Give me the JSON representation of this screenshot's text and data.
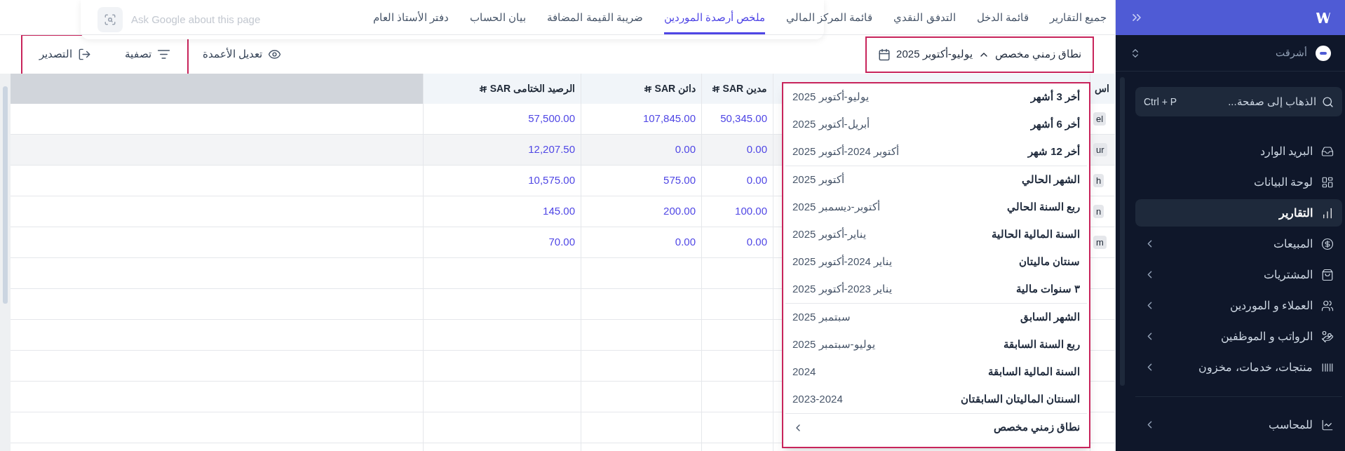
{
  "assistant_popup": {
    "placeholder": "Ask Google about this page"
  },
  "tabs": [
    {
      "label": "جميع التقارير",
      "selected": false
    },
    {
      "label": "قائمة الدخل",
      "selected": false
    },
    {
      "label": "التدفق النقدي",
      "selected": false
    },
    {
      "label": "قائمة المركز المالي",
      "selected": false
    },
    {
      "label": "ملخص أرصدة الموردين",
      "selected": true
    },
    {
      "label": "ضريبة القيمة المضافة",
      "selected": false
    },
    {
      "label": "بيان الحساب",
      "selected": false
    },
    {
      "label": "دفتر الأستاذ العام",
      "selected": false
    }
  ],
  "toolbar": {
    "date_range": {
      "label": "نطاق زمني مخصص",
      "value": "يوليو-أكتوبر 2025",
      "expanded": true,
      "highlighted": true
    },
    "actions": [
      {
        "kind": "columns",
        "label": "تعديل الأعمدة",
        "highlighted": false
      },
      {
        "kind": "filter",
        "label": "تصفية",
        "highlighted": true
      },
      {
        "kind": "export",
        "label": "التصدير",
        "highlighted": true
      }
    ]
  },
  "table": {
    "columns": [
      {
        "label": "اس"
      },
      {},
      {
        "label": "مدين SAR",
        "currency": true
      },
      {
        "label": "دائن SAR",
        "currency": true
      },
      {
        "label": "الرصيد الختامى SAR",
        "currency": true
      }
    ],
    "rows": [
      {
        "selected": false,
        "cells": [
          "el",
          "",
          "50,345.00",
          "107,845.00",
          "57,500.00"
        ]
      },
      {
        "selected": true,
        "cells": [
          "ur",
          "",
          "0.00",
          "0.00",
          "12,207.50"
        ]
      },
      {
        "selected": false,
        "cells": [
          "h",
          "",
          "0.00",
          "575.00",
          "10,575.00"
        ]
      },
      {
        "selected": false,
        "cells": [
          "n",
          "",
          "100.00",
          "200.00",
          "145.00"
        ]
      },
      {
        "selected": false,
        "cells": [
          "m",
          "",
          "0.00",
          "0.00",
          "70.00"
        ]
      }
    ]
  },
  "range_menu": {
    "highlighted": true,
    "groups": [
      [
        {
          "label": "أخر 3 أشهر",
          "range": "يوليو-أكتوبر 2025"
        },
        {
          "label": "أخر 6 أشهر",
          "range": "أبريل-أكتوبر 2025"
        },
        {
          "label": "أخر 12 شهر",
          "range": "أكتوبر 2024-أكتوبر 2025"
        }
      ],
      [
        {
          "label": "الشهر الحالي",
          "range": "أكتوبر 2025"
        },
        {
          "label": "ربع السنة الحالي",
          "range": "أكتوبر-ديسمبر 2025"
        },
        {
          "label": "السنة المالية الحالية",
          "range": "يناير-أكتوبر 2025"
        },
        {
          "label": "سنتان ماليتان",
          "range": "يناير 2024-أكتوبر 2025"
        },
        {
          "label": "٣ سنوات مالية",
          "range": "يناير 2023-أكتوبر 2025"
        }
      ],
      [
        {
          "label": "الشهر السابق",
          "range": "سبتمبر 2025"
        },
        {
          "label": "ربع السنة السابقة",
          "range": "يوليو-سبتمبر 2025"
        },
        {
          "label": "السنة المالية السابقة",
          "range": "2024"
        },
        {
          "label": "السنتان الماليتان السابقتان",
          "range": "2023-2024"
        }
      ]
    ],
    "custom": {
      "label": "نطاق زمني مخصص"
    }
  },
  "sidebar": {
    "account": {
      "name": "أشرقت"
    },
    "search": {
      "placeholder": "الذهاب إلى صفحة...",
      "shortcut": "Ctrl + P"
    },
    "items": [
      {
        "kind": "inbox",
        "label": "البريد الوارد",
        "selected": false,
        "expandable": false
      },
      {
        "kind": "dashboard",
        "label": "لوحة البيانات",
        "selected": false,
        "expandable": false
      },
      {
        "kind": "reports",
        "label": "التقارير",
        "selected": true,
        "expandable": false
      },
      {
        "kind": "sales",
        "label": "المبيعات",
        "selected": false,
        "expandable": true
      },
      {
        "kind": "purchases",
        "label": "المشتريات",
        "selected": false,
        "expandable": true
      },
      {
        "kind": "contacts",
        "label": "العملاء و الموردين",
        "selected": false,
        "expandable": true
      },
      {
        "kind": "payroll",
        "label": "الرواتب و الموظفين",
        "selected": false,
        "expandable": true
      },
      {
        "kind": "products",
        "label": "منتجات، خدمات، مخزون",
        "selected": false,
        "expandable": true
      }
    ],
    "footer_items": [
      {
        "kind": "accountant",
        "label": "للمحاسب",
        "selected": false,
        "expandable": true
      }
    ]
  }
}
